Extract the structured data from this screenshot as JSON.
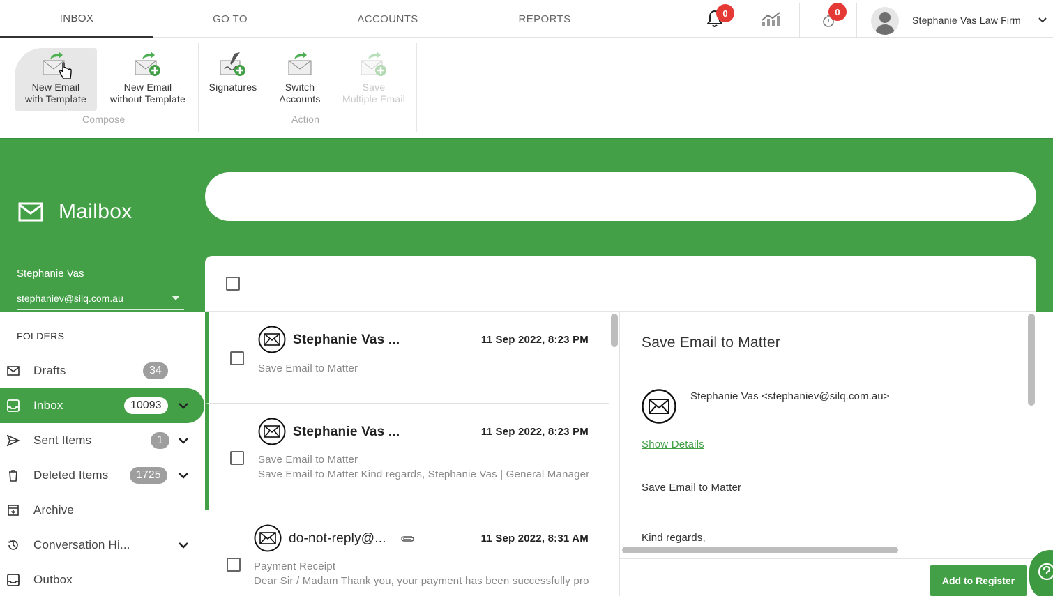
{
  "topnav": {
    "tabs": [
      {
        "label": "INBOX",
        "active": true
      },
      {
        "label": "GO TO",
        "active": false
      },
      {
        "label": "ACCOUNTS",
        "active": false
      },
      {
        "label": "REPORTS",
        "active": false
      }
    ],
    "notifications_count": "0",
    "timers_count": "0",
    "user_name": "Stephanie Vas Law Firm"
  },
  "ribbon": {
    "compose_group": "Compose",
    "action_group": "Action",
    "buttons": {
      "new_with_template": "New Email\nwith Template",
      "new_without_template": "New Email\nwithout Template",
      "signatures": "Signatures",
      "switch_accounts": "Switch\nAccounts",
      "save_multiple": "Save\nMultiple Email"
    }
  },
  "mailbox": {
    "title": "Mailbox",
    "account_name": "Stephanie Vas",
    "account_email": "stephaniev@silq.com.au",
    "search_placeholder": ""
  },
  "sidebar": {
    "heading": "FOLDERS",
    "folders": [
      {
        "label": "Drafts",
        "count": "34",
        "icon": "envelope-icon"
      },
      {
        "label": "Inbox",
        "count": "10093",
        "icon": "inbox-tray-icon",
        "active": true
      },
      {
        "label": "Sent Items",
        "count": "1",
        "icon": "send-icon"
      },
      {
        "label": "Deleted Items",
        "count": "1725",
        "icon": "trash-icon"
      },
      {
        "label": "Archive",
        "count": "",
        "icon": "archive-icon"
      },
      {
        "label": "Conversation Hi...",
        "count": "",
        "icon": "history-icon"
      },
      {
        "label": "Outbox",
        "count": "",
        "icon": "outbox-icon"
      }
    ]
  },
  "emails": [
    {
      "sender": "Stephanie Vas ...",
      "date": "11 Sep 2022, 8:23 PM",
      "subject": "Save Email to Matter",
      "preview": ""
    },
    {
      "sender": "Stephanie Vas ...",
      "date": "11 Sep 2022, 8:23 PM",
      "subject": "Save Email to Matter",
      "preview": "Save Email to Matter Kind regards, Stephanie Vas | General Manager c"
    },
    {
      "sender": "do-not-reply@...",
      "date": "11 Sep 2022, 8:31 AM",
      "subject": "Payment Receipt",
      "preview": "Dear Sir / Madam Thank you, your payment has been successfully proc"
    }
  ],
  "reader": {
    "title": "Save Email to Matter",
    "from": "Stephanie Vas <stephaniev@silq.com.au>",
    "show_details": "Show Details",
    "body_line1": "Save Email to Matter",
    "body_line2": "Kind regards,",
    "add_to_register": "Add to Register"
  },
  "colors": {
    "brand_green": "#44a047",
    "badge_red": "#e53935"
  }
}
